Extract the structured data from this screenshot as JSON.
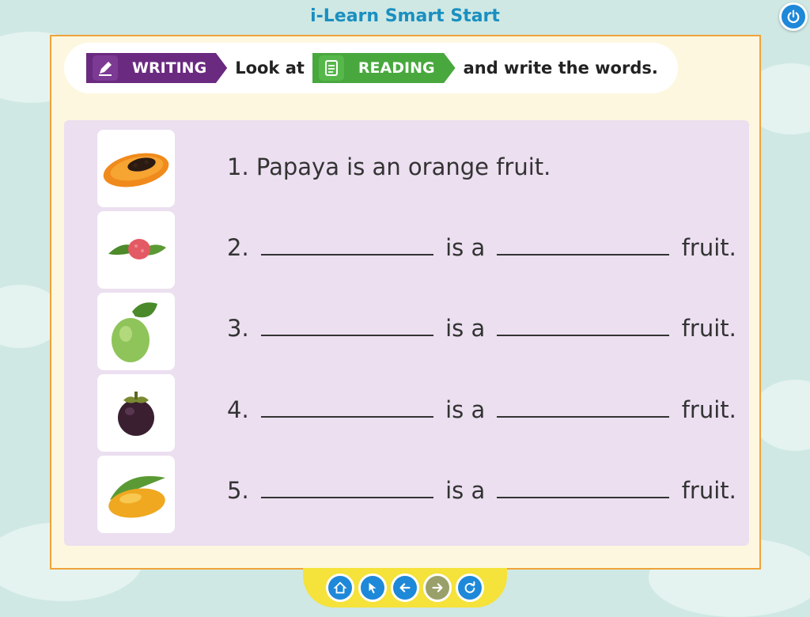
{
  "app": {
    "title": "i-Learn Smart Start"
  },
  "instruction": {
    "writing_label": "WRITING",
    "text_before": "Look at",
    "reading_label": "READING",
    "text_after": "and write the words."
  },
  "exercise": {
    "items": [
      {
        "number": "1.",
        "fruit_icon": "papaya-icon",
        "text": "Papaya is an orange fruit."
      },
      {
        "number": "2.",
        "fruit_icon": "lychee-icon",
        "middle": "is a",
        "end": "fruit."
      },
      {
        "number": "3.",
        "fruit_icon": "guava-icon",
        "middle": "is a",
        "end": "fruit."
      },
      {
        "number": "4.",
        "fruit_icon": "mangosteen-icon",
        "middle": "is a",
        "end": "fruit."
      },
      {
        "number": "5.",
        "fruit_icon": "mango-icon",
        "middle": "is a",
        "end": "fruit."
      }
    ]
  },
  "navigation": {
    "buttons": [
      "home-icon",
      "cursor-icon",
      "back-arrow-icon",
      "forward-arrow-icon",
      "refresh-icon"
    ]
  },
  "colors": {
    "accent_blue": "#1e88d9",
    "writing_purple": "#6a2a80",
    "reading_green": "#48a83e",
    "panel_lavender": "#ebdff0",
    "frame_orange": "#f0a33a"
  }
}
